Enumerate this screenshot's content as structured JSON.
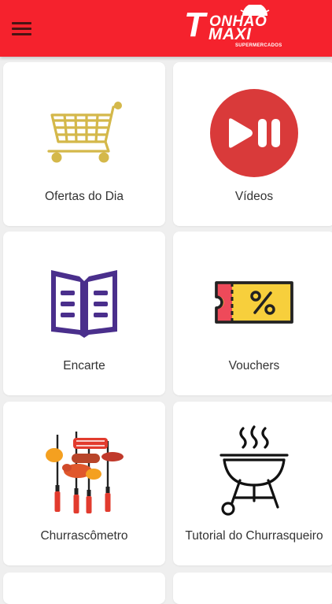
{
  "header": {
    "menu_icon": "hamburger-menu-icon",
    "logo": {
      "letter": "T",
      "line1": "ONHÃO",
      "line2": "MAXI",
      "sub": "SUPERMERCADOS"
    }
  },
  "menu": {
    "items": [
      {
        "label": "Ofertas do Dia",
        "icon": "shopping-cart-icon"
      },
      {
        "label": "Vídeos",
        "icon": "play-pause-icon"
      },
      {
        "label": "Encarte",
        "icon": "book-icon"
      },
      {
        "label": "Vouchers",
        "icon": "voucher-ticket-icon"
      },
      {
        "label": "Churrascômetro",
        "icon": "barbecue-skewers-icon"
      },
      {
        "label": "Tutorial do Churrasqueiro",
        "icon": "grill-icon"
      }
    ]
  },
  "colors": {
    "header_bg": "#f5222d",
    "cart": "#d4b84a",
    "play_circle": "#d93a3a",
    "book": "#4a2f8c",
    "voucher_yellow": "#f7cf3c",
    "voucher_red": "#ee4a5a"
  }
}
